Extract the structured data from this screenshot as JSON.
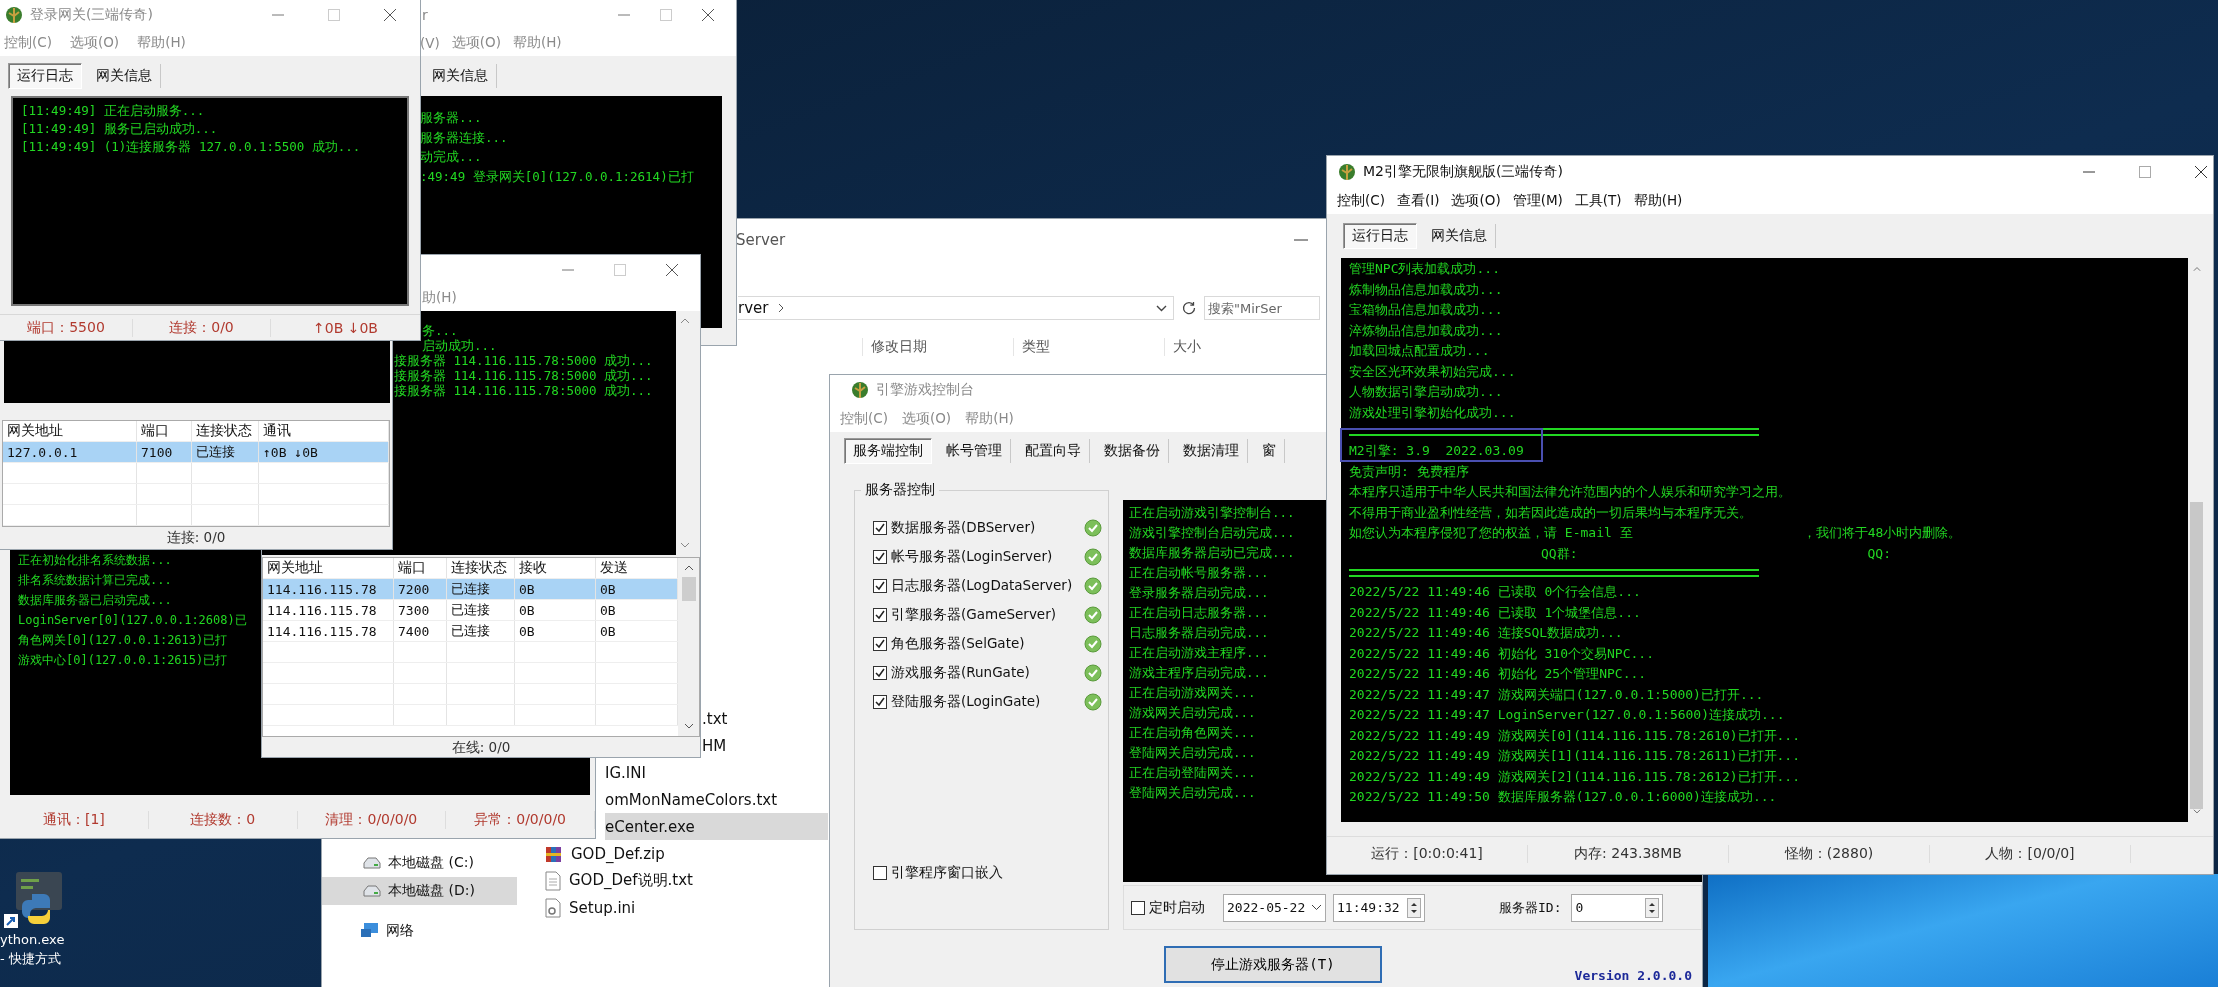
{
  "desktop": {
    "shortcut_label": [
      "ython.exe",
      "- 快捷方式"
    ]
  },
  "explorer": {
    "title": "Server",
    "address": "rver",
    "search": {
      "placeholder": "搜索\"MirSer"
    },
    "columns": [
      "修改日期",
      "类型",
      "大小"
    ],
    "nav": [
      {
        "label": "本地磁盘 (C:)",
        "kind": "drive",
        "selected": false
      },
      {
        "label": "本地磁盘 (D:)",
        "kind": "drive",
        "selected": true
      },
      {
        "label": "网络",
        "kind": "network",
        "selected": false
      }
    ],
    "files": [
      {
        "name": ".txt",
        "kind": "cut",
        "selected": false
      },
      {
        "name": "HM",
        "kind": "cut",
        "selected": false
      },
      {
        "name": "IG.INI",
        "kind": "cut",
        "selected": false
      },
      {
        "name": "omMonNameColors.txt",
        "kind": "cut",
        "selected": false
      },
      {
        "name": "eCenter.exe",
        "kind": "cut",
        "selected": true
      },
      {
        "name": "GOD_Def.zip",
        "kind": "zip",
        "selected": false
      },
      {
        "name": "GOD_Def说明.txt",
        "kind": "txt",
        "selected": false
      },
      {
        "name": "Setup.ini",
        "kind": "ini",
        "selected": false
      }
    ]
  },
  "engine_console": {
    "title": "引擎游戏控制台",
    "menu": [
      "控制(C)",
      "选项(O)",
      "帮助(H)"
    ],
    "tabs": [
      {
        "label": "服务端控制",
        "selected": true
      },
      {
        "label": "帐号管理",
        "selected": false
      },
      {
        "label": "配置向导",
        "selected": false
      },
      {
        "label": "数据备份",
        "selected": false
      },
      {
        "label": "数据清理",
        "selected": false
      },
      {
        "label": "窗",
        "selected": false
      }
    ],
    "group_title": "服务器控制",
    "servers": [
      {
        "label": "数据服务器(DBServer)",
        "checked": true,
        "running": true
      },
      {
        "label": "帐号服务器(LoginServer)",
        "checked": true,
        "running": true
      },
      {
        "label": "日志服务器(LogDataServer)",
        "checked": true,
        "running": true
      },
      {
        "label": "引擎服务器(GameServer)",
        "checked": true,
        "running": true
      },
      {
        "label": "角色服务器(SelGate)",
        "checked": true,
        "running": true
      },
      {
        "label": "游戏服务器(RunGate)",
        "checked": true,
        "running": true
      },
      {
        "label": "登陆服务器(LoginGate)",
        "checked": true,
        "running": true
      }
    ],
    "embed": {
      "label": "引擎程序窗口嵌入",
      "checked": false
    },
    "log": [
      "正在启动游戏引擎控制台...",
      "游戏引擎控制台启动完成...",
      "数据库服务器启动已完成...",
      "正在启动帐号服务器...",
      "登录服务器启动完成...",
      "正在启动日志服务器...",
      "日志服务器启动完成...",
      "正在启动游戏主程序...",
      "游戏主程序启动完成...",
      "正在启动游戏网关...",
      "游戏网关启动完成...",
      "正在启动角色网关...",
      "登陆网关启动完成...",
      "正在启动登陆网关...",
      "登陆网关启动完成..."
    ],
    "schedule": {
      "label": "定时启动",
      "checked": false
    },
    "date": "2022-05-22",
    "time": "11:49:32",
    "server_id_label": "服务器ID:",
    "server_id": "0",
    "stop_button": "停止游戏服务器(T)",
    "version": "Version 2.0.0.0"
  },
  "m2_window": {
    "title": "M2引擎无限制旗舰版(三端传奇)",
    "menu": [
      "控制(C)",
      "查看(I)",
      "选项(O)",
      "管理(M)",
      "工具(T)",
      "帮助(H)"
    ],
    "tabs": [
      {
        "label": "运行日志",
        "selected": true
      },
      {
        "label": "网关信息",
        "selected": false
      }
    ],
    "log": [
      {
        "kind": "text",
        "text": "管理NPC列表加载成功..."
      },
      {
        "kind": "text",
        "text": "炼制物品信息加载成功..."
      },
      {
        "kind": "text",
        "text": "宝箱物品信息加载成功..."
      },
      {
        "kind": "text",
        "text": "淬炼物品信息加载成功..."
      },
      {
        "kind": "text",
        "text": "加载回城点配置成功..."
      },
      {
        "kind": "text",
        "text": "安全区光环效果初始完成..."
      },
      {
        "kind": "text",
        "text": "人物数据引擎启动成功..."
      },
      {
        "kind": "text",
        "text": "游戏处理引擎初始化成功..."
      },
      {
        "kind": "rule"
      },
      {
        "kind": "version",
        "text": "M2引擎: 3.9  2022.03.09",
        "highlighted": true
      },
      {
        "kind": "text",
        "text": "免责声明: 免费程序"
      },
      {
        "kind": "text",
        "text": "本程序只适用于中华人民共和国法律允许范围内的个人娱乐和研究学习之用。"
      },
      {
        "kind": "text",
        "text": "不得用于商业盈利性经营，如若因此造成的一切后果均与本程序无关。"
      },
      {
        "kind": "split",
        "parts": [
          "如您认为本程序侵犯了您的权益，请 E-mail 至",
          "，我们将于48小时内删除。"
        ]
      },
      {
        "kind": "contacts",
        "parts": [
          "QQ群:",
          "QQ:"
        ]
      },
      {
        "kind": "rule"
      },
      {
        "kind": "text",
        "text": "2022/5/22 11:49:46 已读取 0个行会信息..."
      },
      {
        "kind": "text",
        "text": "2022/5/22 11:49:46 已读取 1个城堡信息..."
      },
      {
        "kind": "text",
        "text": "2022/5/22 11:49:46 连接SQL数据成功..."
      },
      {
        "kind": "text",
        "text": "2022/5/22 11:49:46 初始化 310个交易NPC..."
      },
      {
        "kind": "text",
        "text": "2022/5/22 11:49:46 初始化 25个管理NPC..."
      },
      {
        "kind": "text",
        "text": "2022/5/22 11:49:47 游戏网关端口(127.0.0.1:5000)已打开..."
      },
      {
        "kind": "text",
        "text": "2022/5/22 11:49:47 LoginServer(127.0.0.1:5600)连接成功..."
      },
      {
        "kind": "text",
        "text": "2022/5/22 11:49:49 游戏网关[0](114.116.115.78:2610)已打开..."
      },
      {
        "kind": "text",
        "text": "2022/5/22 11:49:49 游戏网关[1](114.116.115.78:2611)已打开..."
      },
      {
        "kind": "text",
        "text": "2022/5/22 11:49:49 游戏网关[2](114.116.115.78:2612)已打开..."
      },
      {
        "kind": "text",
        "text": "2022/5/22 11:49:50 数据库服务器(127.0.0.1:6000)连接成功..."
      }
    ],
    "status": [
      "运行：[0:0:0:41]",
      "内存: 243.38MB",
      "怪物：(2880)",
      "人物：[0/0/0]"
    ]
  },
  "db_window": {
    "log": [
      "正在初始化排名系统数据...",
      "排名系统数据计算已完成...",
      "数据库服务器已启动完成...",
      "LoginServer[0](127.0.0.1:2608)已",
      "角色网关[0](127.0.0.1:2613)已打",
      "游戏中心[0](127.0.0.1:2615)已打"
    ],
    "status": [
      "通讯：[1]",
      "连接数：0",
      "清理：0/0/0/0",
      "异常：0/0/0/0"
    ]
  },
  "gate_window": {
    "title": "r",
    "menu": [
      "(V)",
      "选项(O)",
      "帮助(H)"
    ],
    "tabs": [
      {
        "label": "网关信息",
        "selected": false
      }
    ],
    "log": [
      "服务器...",
      "服务器连接...",
      "动完成...",
      ":49:49 登录网关[0](127.0.0.1:2614)已打"
    ]
  },
  "run_gate_window": {
    "menu": [
      "助(H)"
    ],
    "log": [
      "务...",
      "启动成功...",
      "接服务器 114.116.115.78:5000 成功...",
      "接服务器 114.116.115.78:5000 成功...",
      "接服务器 114.116.115.78:5000 成功..."
    ],
    "table": {
      "columns": [
        "网关地址",
        "端口",
        "连接状态",
        "接收",
        "发送"
      ],
      "rows": [
        {
          "cells": [
            "114.116.115.78",
            "7200",
            "已连接",
            "0B",
            "0B"
          ],
          "selected": true
        },
        {
          "cells": [
            "114.116.115.78",
            "7300",
            "已连接",
            "0B",
            "0B"
          ],
          "selected": false
        },
        {
          "cells": [
            "114.116.115.78",
            "7400",
            "已连接",
            "0B",
            "0B"
          ],
          "selected": false
        }
      ]
    },
    "status": "在线: 0/0"
  },
  "sel_gate_window": {
    "table": {
      "columns": [
        "网关地址",
        "端口",
        "连接状态",
        "通讯"
      ],
      "rows": [
        {
          "cells": [
            "127.0.0.1",
            "7100",
            "已连接",
            "↑0B  ↓0B"
          ],
          "selected": true
        }
      ]
    },
    "status": "连接: 0/0"
  },
  "login_gate_window": {
    "title": "登录网关(三端传奇)",
    "menu": [
      "控制(C)",
      "选项(O)",
      "帮助(H)"
    ],
    "tabs": [
      {
        "label": "运行日志",
        "selected": true
      },
      {
        "label": "网关信息",
        "selected": false
      }
    ],
    "log": [
      "[11:49:49] 正在启动服务...",
      "[11:49:49] 服务已启动成功...",
      "[11:49:49] (1)连接服务器 127.0.0.1:5500 成功..."
    ],
    "status": [
      "端口：5500",
      "连接：0/0",
      "↑0B  ↓0B"
    ]
  }
}
